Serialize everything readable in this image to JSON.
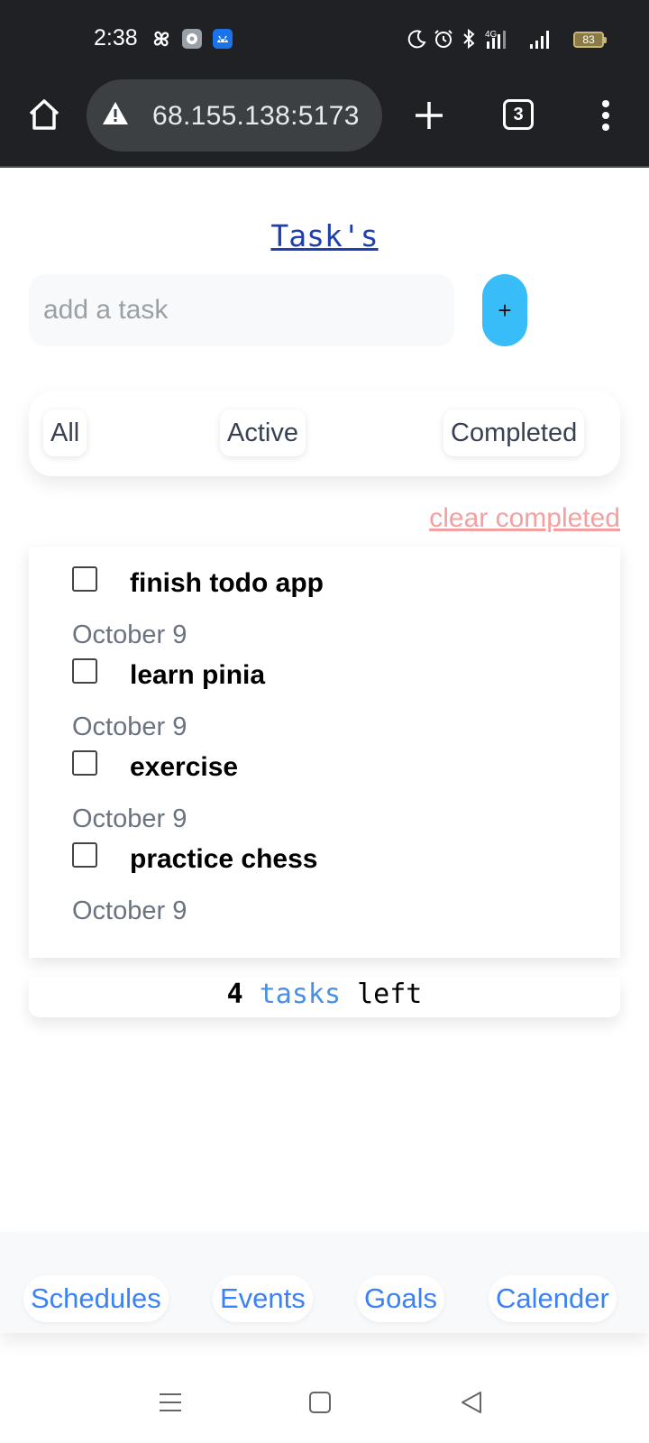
{
  "status_bar": {
    "time": "2:38",
    "battery_level": "83",
    "network_type": "4G",
    "icons": [
      "pinwheel-icon",
      "settings-app-icon",
      "android-debug-icon",
      "moon-icon",
      "alarm-icon",
      "bluetooth-icon",
      "signal-icon",
      "battery-icon"
    ]
  },
  "browser": {
    "url": "68.155.138:5173",
    "tab_count": "3",
    "icons": [
      "home-icon",
      "warning-icon",
      "plus-icon",
      "menu-dots-icon"
    ]
  },
  "page": {
    "title": "Task's",
    "input": {
      "placeholder": "add a task",
      "value": ""
    },
    "add_button": "+",
    "filters": [
      "All",
      "Active",
      "Completed"
    ],
    "clear_completed": "clear completed",
    "tasks": [
      {
        "name": "finish todo app",
        "date": "October 9",
        "completed": false
      },
      {
        "name": "learn pinia",
        "date": "October 9",
        "completed": false
      },
      {
        "name": "exercise",
        "date": "October 9",
        "completed": false
      },
      {
        "name": "practice chess",
        "date": "October 9",
        "completed": false
      }
    ],
    "tasks_left": {
      "count": "4",
      "word": "tasks",
      "suffix": "left"
    }
  },
  "bottom_nav": [
    "Schedules",
    "Events",
    "Goals",
    "Calender"
  ],
  "colors": {
    "title": "#1e40af",
    "accent": "#38bdf8",
    "nav_text": "#3b82f6",
    "clear_link": "#f4a0a0",
    "chrome_bg": "#202124"
  }
}
